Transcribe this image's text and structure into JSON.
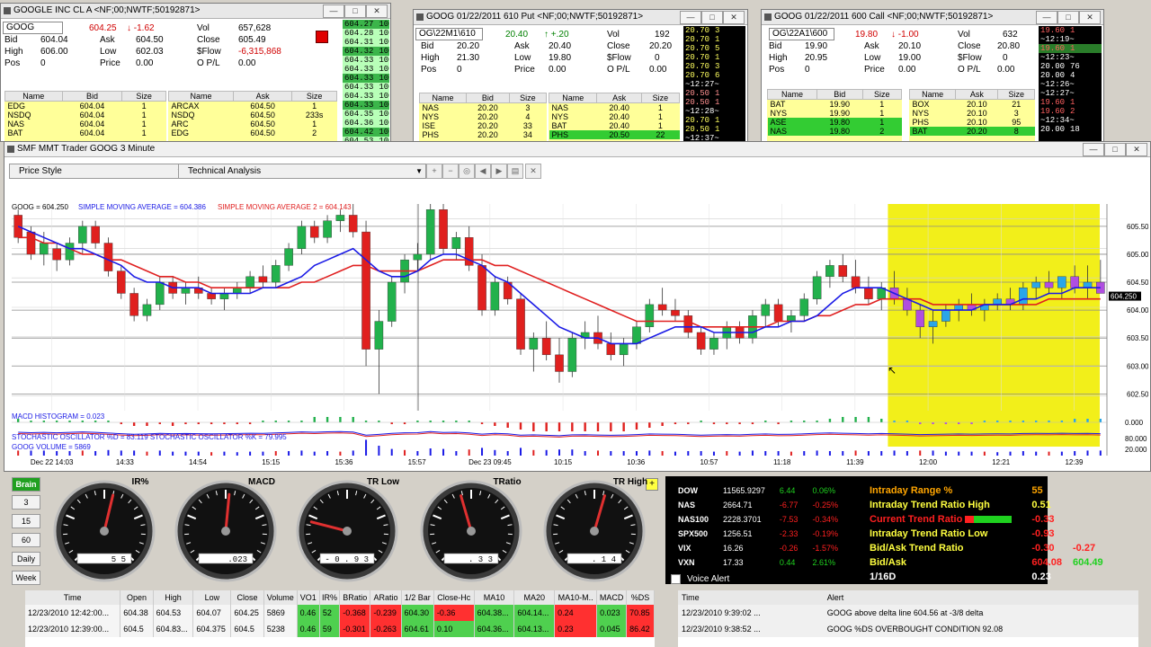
{
  "win1": {
    "title": "GOOGLE INC CL A <NF;00;NWTF;50192871>",
    "symbol": "GOOG",
    "last": "604.25",
    "change": "-1.62",
    "vol_label": "Vol",
    "vol": "657,628",
    "bid_label": "Bid",
    "bid": "604.04",
    "ask_label": "Ask",
    "ask": "604.50",
    "close_label": "Close",
    "close": "605.49",
    "high_label": "High",
    "high": "606.00",
    "low_label": "Low",
    "low": "602.03",
    "sflow_label": "$Flow",
    "sflow": "-6,315,868",
    "pos_label": "Pos",
    "pos": "0",
    "price_label": "Price",
    "price": "0.00",
    "opl_label": "O P/L",
    "opl": "0.00",
    "book_bid_headers": [
      "Name",
      "Bid",
      "Size"
    ],
    "book_ask_headers": [
      "Name",
      "Ask",
      "Size"
    ],
    "book_bids": [
      [
        "EDG",
        "604.04",
        "1"
      ],
      [
        "NSDQ",
        "604.04",
        "1"
      ],
      [
        "NAS",
        "604.04",
        "1"
      ],
      [
        "BAT",
        "604.04",
        "1"
      ]
    ],
    "book_asks": [
      [
        "ARCAX",
        "604.50",
        "1"
      ],
      [
        "NSDQ",
        "604.50",
        "233s"
      ],
      [
        "ARC",
        "604.50",
        "1"
      ],
      [
        "EDG",
        "604.50",
        "2"
      ]
    ],
    "ladder": [
      [
        "604.27",
        "100"
      ],
      [
        "604.28",
        "100"
      ],
      [
        "604.31",
        "100"
      ],
      [
        "604.32",
        "100"
      ],
      [
        "604.33",
        "100"
      ],
      [
        "604.33",
        "100"
      ],
      [
        "604.33",
        "100"
      ],
      [
        "604.33",
        "100"
      ],
      [
        "604.33",
        "100"
      ],
      [
        "604.33",
        "100"
      ],
      [
        "604.35",
        "100"
      ],
      [
        "604.36",
        "100"
      ],
      [
        "604.42",
        "100"
      ],
      [
        "604.53",
        "100"
      ]
    ]
  },
  "win2": {
    "title": "GOOG 01/22/2011 610 Put <NF;00;NWTF;50192871>",
    "symbol": "OG\\22M1\\610",
    "last": "20.40",
    "change": "+.20",
    "vol_label": "Vol",
    "vol": "192",
    "bid_label": "Bid",
    "bid": "20.20",
    "ask_label": "Ask",
    "ask": "20.40",
    "close_label": "Close",
    "close": "20.20",
    "high_label": "High",
    "high": "21.30",
    "low_label": "Low",
    "low": "19.80",
    "sflow_label": "$Flow",
    "sflow": "0",
    "pos_label": "Pos",
    "pos": "0",
    "price_label": "Price",
    "price": "0.00",
    "opl_label": "O P/L",
    "opl": "0.00",
    "book_bid_headers": [
      "Name",
      "Bid",
      "Size"
    ],
    "book_ask_headers": [
      "Name",
      "Ask",
      "Size"
    ],
    "book_bids": [
      [
        "NAS",
        "20.20",
        "3"
      ],
      [
        "NYS",
        "20.20",
        "4"
      ],
      [
        "ISE",
        "20.20",
        "33"
      ],
      [
        "PHS",
        "20.20",
        "34"
      ]
    ],
    "book_asks": [
      [
        "NAS",
        "20.40",
        "1"
      ],
      [
        "NYS",
        "20.40",
        "1"
      ],
      [
        "BAT",
        "20.40",
        "1"
      ],
      [
        "PHS",
        "20.50",
        "22"
      ]
    ],
    "ladder": [
      [
        "20.70",
        "3"
      ],
      [
        "20.70",
        "1"
      ],
      [
        "20.70",
        "5"
      ],
      [
        "20.70",
        "1"
      ],
      [
        "20.70",
        "3"
      ],
      [
        "20.70",
        "6"
      ],
      [
        "~12:27~",
        ""
      ],
      [
        "20.50",
        "1"
      ],
      [
        "20.50",
        "1"
      ],
      [
        "~12:28~",
        ""
      ],
      [
        "20.70",
        "1"
      ],
      [
        "20.50",
        "1"
      ],
      [
        "~12:37~",
        ""
      ]
    ]
  },
  "win3": {
    "title": "GOOG 01/22/2011 600 Call <NF;00;NWTF;50192871>",
    "symbol": "OG\\22A1\\600",
    "last": "19.80",
    "change": "-1.00",
    "vol_label": "Vol",
    "vol": "632",
    "bid_label": "Bid",
    "bid": "19.90",
    "ask_label": "Ask",
    "ask": "20.10",
    "close_label": "Close",
    "close": "20.80",
    "high_label": "High",
    "high": "20.95",
    "low_label": "Low",
    "low": "19.00",
    "sflow_label": "$Flow",
    "sflow": "0",
    "pos_label": "Pos",
    "pos": "0",
    "price_label": "Price",
    "price": "0.00",
    "opl_label": "O P/L",
    "opl": "0.00",
    "book_bid_headers": [
      "Name",
      "Bid",
      "Size"
    ],
    "book_ask_headers": [
      "Name",
      "Ask",
      "Size"
    ],
    "book_bids": [
      [
        "BAT",
        "19.90",
        "1"
      ],
      [
        "NYS",
        "19.90",
        "1"
      ],
      [
        "ASE",
        "19.80",
        "1"
      ],
      [
        "NAS",
        "19.80",
        "2"
      ]
    ],
    "book_asks": [
      [
        "BOX",
        "20.10",
        "21"
      ],
      [
        "NYS",
        "20.10",
        "3"
      ],
      [
        "PHS",
        "20.10",
        "95"
      ],
      [
        "BAT",
        "20.20",
        "8"
      ]
    ],
    "ladder": [
      [
        "19.60",
        "1"
      ],
      [
        "~12:19~",
        ""
      ],
      [
        "19.60",
        "1"
      ],
      [
        "~12:23~",
        ""
      ],
      [
        "20.00",
        "76"
      ],
      [
        "20.00",
        "4"
      ],
      [
        "~12:26~",
        ""
      ],
      [
        "~12:27~",
        ""
      ],
      [
        "19.60",
        "1"
      ],
      [
        "19.60",
        "2"
      ],
      [
        "~12:34~",
        ""
      ],
      [
        "20.00",
        "18"
      ]
    ]
  },
  "chart": {
    "title": "SMF MMT Trader GOOG  3 Minute",
    "price_style_label": "Price Style",
    "technical_label": "Technical Analysis",
    "legend_sym": "GOOG = 604.250",
    "legend_sma1": "SIMPLE MOVING AVERAGE = 604.386",
    "legend_sma2": "SIMPLE MOVING AVERAGE 2 = 604.143",
    "macd_label": "MACD HISTOGRAM = 0.023",
    "stoch_label": "STOCHASTIC OSCILLATOR %D = 83.119   STOCHASTIC OSCILLATOR %K = 79.995",
    "volume_label": "GOOG VOLUME = 5869",
    "last_price_tag": "604.250",
    "colors": {
      "up": "#22b14c",
      "down": "#e0201e",
      "sma1": "#1a1ae6",
      "sma2": "#e02020",
      "highlight": "#f2ef1a"
    }
  },
  "chart_data": {
    "type": "candlestick",
    "y_ticks": [
      "605.500",
      "605.000",
      "604.500",
      "604.000",
      "603.500",
      "603.000",
      "602.500"
    ],
    "ylim": [
      602.2,
      605.9
    ],
    "x_ticks": [
      "Dec 22 14:03",
      "14:33",
      "14:54",
      "15:15",
      "15:36",
      "15:57",
      "Dec 23 09:45",
      "10:15",
      "10:36",
      "10:57",
      "11:18",
      "11:39",
      "12:00",
      "12:21",
      "12:39"
    ],
    "macd_ticks": [
      "0.000",
      "80.000",
      "20.000"
    ],
    "candles": [
      [
        605.7,
        605.8,
        605.2,
        605.3
      ],
      [
        605.4,
        605.5,
        604.9,
        605.0
      ],
      [
        605.0,
        605.4,
        604.8,
        605.2
      ],
      [
        605.1,
        605.2,
        604.7,
        604.9
      ],
      [
        604.9,
        605.3,
        604.8,
        605.2
      ],
      [
        605.2,
        605.6,
        605.0,
        605.5
      ],
      [
        605.5,
        605.6,
        605.1,
        605.2
      ],
      [
        605.2,
        605.3,
        604.6,
        604.7
      ],
      [
        604.7,
        604.8,
        604.2,
        604.3
      ],
      [
        604.3,
        604.4,
        603.8,
        603.9
      ],
      [
        603.9,
        604.2,
        603.8,
        604.1
      ],
      [
        604.1,
        604.6,
        604.0,
        604.5
      ],
      [
        604.5,
        604.6,
        604.2,
        604.3
      ],
      [
        604.3,
        604.5,
        604.1,
        604.4
      ],
      [
        604.4,
        604.6,
        604.2,
        604.3
      ],
      [
        604.3,
        604.4,
        604.1,
        604.2
      ],
      [
        604.2,
        604.4,
        604.0,
        604.3
      ],
      [
        604.3,
        604.5,
        604.2,
        604.4
      ],
      [
        604.4,
        604.7,
        604.3,
        604.6
      ],
      [
        604.6,
        604.8,
        604.4,
        604.5
      ],
      [
        604.5,
        604.9,
        604.4,
        604.8
      ],
      [
        604.8,
        605.2,
        604.7,
        605.1
      ],
      [
        605.1,
        605.6,
        605.0,
        605.5
      ],
      [
        605.5,
        605.6,
        605.2,
        605.3
      ],
      [
        605.3,
        605.7,
        605.2,
        605.6
      ],
      [
        605.6,
        605.8,
        605.4,
        605.7
      ],
      [
        605.7,
        605.9,
        605.3,
        605.4
      ],
      [
        605.4,
        605.6,
        603.0,
        603.3
      ],
      [
        603.3,
        604.0,
        602.5,
        603.8
      ],
      [
        603.8,
        604.6,
        603.7,
        604.5
      ],
      [
        604.5,
        605.0,
        604.3,
        604.9
      ],
      [
        604.9,
        605.2,
        604.7,
        605.0
      ],
      [
        605.0,
        605.9,
        604.9,
        605.8
      ],
      [
        605.8,
        605.9,
        605.0,
        605.1
      ],
      [
        605.1,
        605.4,
        604.9,
        605.3
      ],
      [
        605.3,
        605.5,
        604.7,
        604.8
      ],
      [
        604.8,
        605.0,
        603.9,
        604.0
      ],
      [
        604.0,
        604.6,
        603.9,
        604.5
      ],
      [
        604.5,
        604.6,
        604.1,
        604.2
      ],
      [
        604.2,
        604.3,
        603.2,
        603.3
      ],
      [
        603.3,
        603.6,
        602.9,
        603.5
      ],
      [
        603.5,
        603.8,
        603.1,
        603.2
      ],
      [
        603.2,
        603.5,
        602.7,
        602.9
      ],
      [
        602.9,
        603.6,
        602.8,
        603.5
      ],
      [
        603.5,
        603.8,
        603.3,
        603.6
      ],
      [
        603.6,
        603.9,
        603.3,
        603.4
      ],
      [
        603.4,
        603.6,
        603.1,
        603.2
      ],
      [
        603.2,
        603.5,
        603.0,
        603.4
      ],
      [
        603.4,
        603.8,
        603.3,
        603.7
      ],
      [
        603.7,
        604.2,
        603.6,
        604.1
      ],
      [
        604.1,
        604.4,
        603.9,
        604.0
      ],
      [
        604.0,
        604.2,
        603.8,
        603.9
      ],
      [
        603.9,
        604.0,
        603.5,
        603.6
      ],
      [
        603.6,
        603.7,
        603.2,
        603.3
      ],
      [
        603.3,
        603.6,
        603.2,
        603.5
      ],
      [
        603.5,
        603.8,
        603.3,
        603.7
      ],
      [
        603.7,
        603.8,
        603.4,
        603.5
      ],
      [
        603.5,
        604.0,
        603.4,
        603.9
      ],
      [
        603.9,
        604.2,
        603.7,
        604.1
      ],
      [
        604.1,
        604.2,
        603.7,
        603.8
      ],
      [
        603.8,
        604.0,
        603.6,
        603.9
      ],
      [
        603.9,
        604.3,
        603.8,
        604.2
      ],
      [
        604.2,
        604.7,
        604.1,
        604.6
      ],
      [
        604.6,
        604.9,
        604.4,
        604.8
      ],
      [
        604.8,
        605.0,
        604.5,
        604.6
      ],
      [
        604.6,
        604.9,
        604.3,
        604.4
      ],
      [
        604.4,
        604.6,
        604.1,
        604.2
      ],
      [
        604.2,
        604.5,
        604.0,
        604.4
      ],
      [
        604.4,
        604.7,
        604.1,
        604.2
      ],
      [
        604.2,
        604.4,
        603.9,
        604.0
      ],
      [
        604.0,
        604.1,
        603.5,
        603.7
      ],
      [
        603.7,
        604.0,
        603.4,
        603.8
      ],
      [
        603.8,
        604.1,
        603.7,
        604.0
      ],
      [
        604.0,
        604.2,
        603.8,
        604.1
      ],
      [
        604.1,
        604.3,
        603.9,
        604.0
      ],
      [
        604.0,
        604.2,
        603.8,
        604.1
      ],
      [
        604.1,
        604.3,
        604.0,
        604.2
      ],
      [
        604.2,
        604.4,
        604.0,
        604.1
      ],
      [
        604.1,
        604.5,
        604.0,
        604.4
      ],
      [
        604.4,
        604.6,
        604.2,
        604.5
      ],
      [
        604.5,
        604.7,
        604.3,
        604.4
      ],
      [
        604.4,
        604.6,
        604.2,
        604.6
      ],
      [
        604.6,
        604.8,
        604.3,
        604.4
      ],
      [
        604.4,
        604.8,
        604.2,
        604.5
      ],
      [
        604.5,
        604.9,
        604.3,
        604.3
      ]
    ],
    "sma1": [
      605.5,
      605.4,
      605.3,
      605.2,
      605.1,
      605.1,
      605.0,
      604.9,
      604.8,
      604.6,
      604.5,
      604.5,
      604.4,
      604.4,
      604.4,
      604.3,
      604.3,
      604.3,
      604.3,
      604.4,
      604.4,
      604.5,
      604.6,
      604.8,
      604.9,
      605.0,
      605.1,
      604.9,
      604.7,
      604.6,
      604.6,
      604.7,
      604.9,
      605.0,
      605.0,
      604.9,
      604.8,
      604.6,
      604.5,
      604.3,
      604.1,
      603.9,
      603.7,
      603.6,
      603.5,
      603.5,
      603.4,
      603.4,
      603.4,
      603.5,
      603.6,
      603.7,
      603.7,
      603.7,
      603.6,
      603.6,
      603.6,
      603.6,
      603.7,
      603.7,
      603.8,
      603.8,
      603.9,
      604.1,
      604.3,
      604.4,
      604.4,
      604.4,
      604.3,
      604.2,
      604.1,
      604.0,
      604.0,
      604.0,
      604.0,
      604.1,
      604.1,
      604.1,
      604.2,
      604.2,
      604.3,
      604.3,
      604.4,
      604.4,
      604.4
    ],
    "sma2": [
      605.3,
      605.3,
      605.2,
      605.2,
      605.1,
      605.0,
      605.0,
      604.9,
      604.9,
      604.8,
      604.7,
      604.6,
      604.6,
      604.5,
      604.5,
      604.4,
      604.4,
      604.4,
      604.4,
      604.4,
      604.4,
      604.4,
      604.5,
      604.5,
      604.6,
      604.7,
      604.8,
      604.8,
      604.7,
      604.7,
      604.7,
      604.7,
      604.8,
      604.9,
      604.9,
      604.9,
      604.9,
      604.8,
      604.8,
      604.7,
      604.6,
      604.5,
      604.4,
      604.3,
      604.2,
      604.1,
      604.0,
      603.9,
      603.8,
      603.8,
      603.8,
      603.8,
      603.8,
      603.7,
      603.7,
      603.7,
      603.7,
      603.7,
      603.7,
      603.8,
      603.8,
      603.8,
      603.9,
      603.9,
      604.0,
      604.1,
      604.1,
      604.2,
      604.2,
      604.2,
      604.2,
      604.1,
      604.1,
      604.1,
      604.1,
      604.1,
      604.1,
      604.1,
      604.1,
      604.1,
      604.2,
      604.2,
      604.2,
      604.2,
      604.2
    ]
  },
  "gauges": [
    {
      "label": "IR%",
      "readout": "5 5",
      "value": 55
    },
    {
      "label": "MACD",
      "readout": ".023",
      "value": 52
    },
    {
      "label": "TR Low",
      "readout": "- 0 . 9 3",
      "value": 22
    },
    {
      "label": "TRatio",
      "readout": ". 3 3",
      "value": 44
    },
    {
      "label": "TR High",
      "readout": ". 1 4",
      "value": 56
    }
  ],
  "side_buttons": {
    "brain": "Brain",
    "b3": "3",
    "b15": "15",
    "b60": "60",
    "daily": "Daily",
    "week": "Week"
  },
  "market": [
    [
      "DOW",
      "11565.9297",
      "6.44",
      "0.06%"
    ],
    [
      "NAS",
      "2664.71",
      "-6.77",
      "-0.25%"
    ],
    [
      "NAS100",
      "2228.3701",
      "-7.53",
      "-0.34%"
    ],
    [
      "SPX500",
      "1256.51",
      "-2.33",
      "-0.19%"
    ],
    [
      "VIX",
      "16.26",
      "-0.26",
      "-1.57%"
    ],
    [
      "VXN",
      "17.33",
      "0.44",
      "2.61%"
    ]
  ],
  "indicators": {
    "range_label": "Intraday Range %",
    "range": "55",
    "trh_label": "Intraday Trend Ratio High",
    "trh": "0.51",
    "ctr_label": "Current Trend Ratio",
    "ctr": "-0.33",
    "trl_label": "Intraday Trend Ratio Low",
    "trl": "-0.93",
    "batr_label": "Bid/Ask Trend Ratio",
    "batr1": "-0.30",
    "batr2": "-0.27",
    "ba_label": "Bid/Ask",
    "ba_bid": "604.08",
    "ba_ask": "604.49",
    "tick_label": "1/16D",
    "tick": "0.23",
    "voice_label": "Voice Alert"
  },
  "bar_table": {
    "headers": [
      "Time",
      "Open",
      "High",
      "Low",
      "Close",
      "Volume",
      "VO1",
      "IR%",
      "BRatio",
      "ARatio",
      "1/2 Bar",
      "Close-Hc",
      "MA10",
      "MA20",
      "MA10-M..",
      "MACD",
      "%DS"
    ],
    "rows": [
      [
        "12/23/2010 12:42:00...",
        "604.38",
        "604.53",
        "604.07",
        "604.25",
        "5869",
        "0.46",
        "52",
        "-0.368",
        "-0.239",
        "604.30",
        "-0.36",
        "604.38...",
        "604.14...",
        "0.24",
        "0.023",
        "70.85"
      ],
      [
        "12/23/2010 12:39:00...",
        "604.5",
        "604.83...",
        "604.375",
        "604.5",
        "5238",
        "0.46",
        "59",
        "-0.301",
        "-0.263",
        "604.61",
        "0.10",
        "604.36...",
        "604.13...",
        "0.23",
        "0.045",
        "86.42"
      ]
    ]
  },
  "alert_table": {
    "headers": [
      "Time",
      "Alert"
    ],
    "rows": [
      [
        "12/23/2010 9:39:02 ...",
        "GOOG above delta line 604.56 at -3/8 delta"
      ],
      [
        "12/23/2010 9:38:52 ...",
        "GOOG %DS OVERBOUGHT CONDITION 92.08"
      ]
    ]
  }
}
